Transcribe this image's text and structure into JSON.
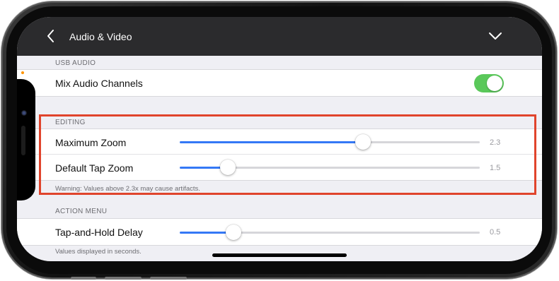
{
  "nav": {
    "title": "Audio & Video",
    "back_icon": "chevron-left-icon",
    "collapse_icon": "chevron-down-icon"
  },
  "usb_audio": {
    "header": "USB AUDIO",
    "mix_label": "Mix Audio Channels",
    "mix_on": true
  },
  "editing": {
    "header": "EDITING",
    "max_zoom_label": "Maximum Zoom",
    "max_zoom_value": "2.3",
    "max_zoom_fraction": 0.61,
    "tap_zoom_label": "Default Tap Zoom",
    "tap_zoom_value": "1.5",
    "tap_zoom_fraction": 0.16,
    "footer": "Warning: Values above 2.3x may cause artifacts."
  },
  "action_menu": {
    "header": "ACTION MENU",
    "delay_label": "Tap-and-Hold Delay",
    "delay_value": "0.5",
    "delay_fraction": 0.18,
    "footer": "Values displayed in seconds."
  },
  "colors": {
    "accent_blue": "#3478f6",
    "toggle_green": "#5ac85a",
    "highlight_red": "#e0442c",
    "navbar": "#2b2b2d"
  }
}
